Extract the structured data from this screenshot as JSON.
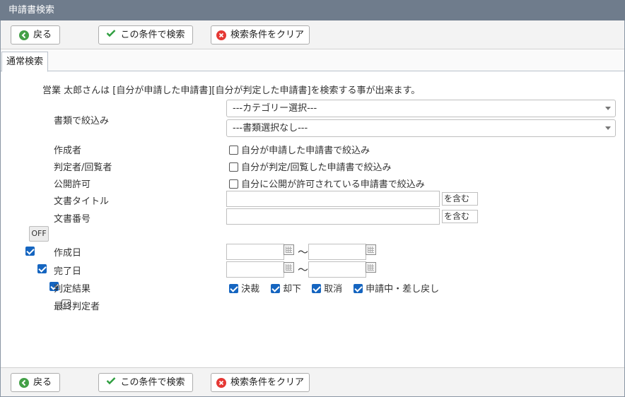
{
  "window": {
    "title": "申請書検索"
  },
  "toolbar": {
    "back_label": "戻る",
    "search_label": "この条件で検索",
    "clear_label": "検索条件をクリア"
  },
  "tabs": [
    {
      "label": "通常検索"
    }
  ],
  "intro_text": "営業 太郎さんは [自分が申請した申請書][自分が判定した申請書]を検索する事が出来ます。",
  "form": {
    "doc_filter": {
      "label": "書類で絞込み",
      "category_select": "---カテゴリー選択---",
      "document_select": "---書類選択なし---"
    },
    "creator": {
      "label": "作成者",
      "checkbox_label": "自分が申請した申請書で絞込み",
      "checked": false
    },
    "judge": {
      "label": "判定者/回覧者",
      "checkbox_label": "自分が判定/回覧した申請書で絞込み",
      "checked": false
    },
    "public": {
      "label": "公開許可",
      "checkbox_label": "自分に公開が許可されている申請書で絞込み",
      "checked": false
    },
    "doc_title": {
      "label": "文書タイトル",
      "value": "",
      "suffix": "を含む"
    },
    "doc_number": {
      "label": "文書番号",
      "value": "",
      "suffix": "を含む"
    },
    "toggle_label": "OFF",
    "created_date": {
      "label": "作成日",
      "checked": true,
      "from": "",
      "to": "",
      "range_sep": "～"
    },
    "completed_date": {
      "label": "完了日",
      "checked": true,
      "from": "",
      "to": "",
      "range_sep": "～"
    },
    "result": {
      "label": "判定結果",
      "checked": true,
      "options": [
        {
          "label": "決裁",
          "checked": true
        },
        {
          "label": "却下",
          "checked": true
        },
        {
          "label": "取消",
          "checked": true
        },
        {
          "label": "申請中・差し戻し",
          "checked": true
        }
      ]
    },
    "final_judge": {
      "label": "最終判定者",
      "checked": false
    }
  },
  "colors": {
    "titlebar": "#6f7c8c",
    "checkbox_checked": "#1565c0",
    "back_icon": "#43a047",
    "search_check": "#2e9e3f",
    "clear_icon": "#e53935"
  }
}
